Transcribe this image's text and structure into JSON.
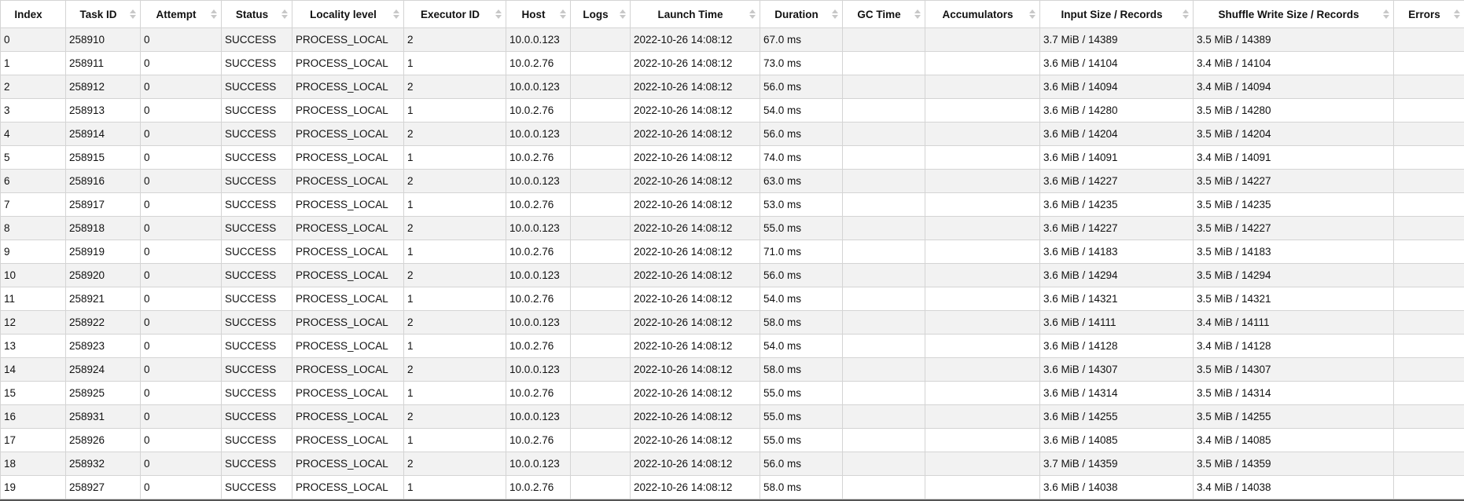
{
  "table": {
    "columns": [
      {
        "key": "index",
        "label": "Index",
        "sortable": false
      },
      {
        "key": "task_id",
        "label": "Task ID",
        "sortable": true
      },
      {
        "key": "attempt",
        "label": "Attempt",
        "sortable": true
      },
      {
        "key": "status",
        "label": "Status",
        "sortable": true
      },
      {
        "key": "locality",
        "label": "Locality level",
        "sortable": true
      },
      {
        "key": "executor_id",
        "label": "Executor ID",
        "sortable": true
      },
      {
        "key": "host",
        "label": "Host",
        "sortable": true
      },
      {
        "key": "logs",
        "label": "Logs",
        "sortable": true
      },
      {
        "key": "launch_time",
        "label": "Launch Time",
        "sortable": true
      },
      {
        "key": "duration",
        "label": "Duration",
        "sortable": true
      },
      {
        "key": "gc_time",
        "label": "GC Time",
        "sortable": true
      },
      {
        "key": "accumulators",
        "label": "Accumulators",
        "sortable": true
      },
      {
        "key": "input_size",
        "label": "Input Size / Records",
        "sortable": true
      },
      {
        "key": "shuffle_write",
        "label": "Shuffle Write Size / Records",
        "sortable": true
      },
      {
        "key": "errors",
        "label": "Errors",
        "sortable": true
      }
    ],
    "rows": [
      [
        "0",
        "258910",
        "0",
        "SUCCESS",
        "PROCESS_LOCAL",
        "2",
        "10.0.0.123",
        "",
        "2022-10-26 14:08:12",
        "67.0 ms",
        "",
        "",
        "3.7 MiB / 14389",
        "3.5 MiB / 14389",
        ""
      ],
      [
        "1",
        "258911",
        "0",
        "SUCCESS",
        "PROCESS_LOCAL",
        "1",
        "10.0.2.76",
        "",
        "2022-10-26 14:08:12",
        "73.0 ms",
        "",
        "",
        "3.6 MiB / 14104",
        "3.4 MiB / 14104",
        ""
      ],
      [
        "2",
        "258912",
        "0",
        "SUCCESS",
        "PROCESS_LOCAL",
        "2",
        "10.0.0.123",
        "",
        "2022-10-26 14:08:12",
        "56.0 ms",
        "",
        "",
        "3.6 MiB / 14094",
        "3.4 MiB / 14094",
        ""
      ],
      [
        "3",
        "258913",
        "0",
        "SUCCESS",
        "PROCESS_LOCAL",
        "1",
        "10.0.2.76",
        "",
        "2022-10-26 14:08:12",
        "54.0 ms",
        "",
        "",
        "3.6 MiB / 14280",
        "3.5 MiB / 14280",
        ""
      ],
      [
        "4",
        "258914",
        "0",
        "SUCCESS",
        "PROCESS_LOCAL",
        "2",
        "10.0.0.123",
        "",
        "2022-10-26 14:08:12",
        "56.0 ms",
        "",
        "",
        "3.6 MiB / 14204",
        "3.5 MiB / 14204",
        ""
      ],
      [
        "5",
        "258915",
        "0",
        "SUCCESS",
        "PROCESS_LOCAL",
        "1",
        "10.0.2.76",
        "",
        "2022-10-26 14:08:12",
        "74.0 ms",
        "",
        "",
        "3.6 MiB / 14091",
        "3.4 MiB / 14091",
        ""
      ],
      [
        "6",
        "258916",
        "0",
        "SUCCESS",
        "PROCESS_LOCAL",
        "2",
        "10.0.0.123",
        "",
        "2022-10-26 14:08:12",
        "63.0 ms",
        "",
        "",
        "3.6 MiB / 14227",
        "3.5 MiB / 14227",
        ""
      ],
      [
        "7",
        "258917",
        "0",
        "SUCCESS",
        "PROCESS_LOCAL",
        "1",
        "10.0.2.76",
        "",
        "2022-10-26 14:08:12",
        "53.0 ms",
        "",
        "",
        "3.6 MiB / 14235",
        "3.5 MiB / 14235",
        ""
      ],
      [
        "8",
        "258918",
        "0",
        "SUCCESS",
        "PROCESS_LOCAL",
        "2",
        "10.0.0.123",
        "",
        "2022-10-26 14:08:12",
        "55.0 ms",
        "",
        "",
        "3.6 MiB / 14227",
        "3.5 MiB / 14227",
        ""
      ],
      [
        "9",
        "258919",
        "0",
        "SUCCESS",
        "PROCESS_LOCAL",
        "1",
        "10.0.2.76",
        "",
        "2022-10-26 14:08:12",
        "71.0 ms",
        "",
        "",
        "3.6 MiB / 14183",
        "3.5 MiB / 14183",
        ""
      ],
      [
        "10",
        "258920",
        "0",
        "SUCCESS",
        "PROCESS_LOCAL",
        "2",
        "10.0.0.123",
        "",
        "2022-10-26 14:08:12",
        "56.0 ms",
        "",
        "",
        "3.6 MiB / 14294",
        "3.5 MiB / 14294",
        ""
      ],
      [
        "11",
        "258921",
        "0",
        "SUCCESS",
        "PROCESS_LOCAL",
        "1",
        "10.0.2.76",
        "",
        "2022-10-26 14:08:12",
        "54.0 ms",
        "",
        "",
        "3.6 MiB / 14321",
        "3.5 MiB / 14321",
        ""
      ],
      [
        "12",
        "258922",
        "0",
        "SUCCESS",
        "PROCESS_LOCAL",
        "2",
        "10.0.0.123",
        "",
        "2022-10-26 14:08:12",
        "58.0 ms",
        "",
        "",
        "3.6 MiB / 14111",
        "3.4 MiB / 14111",
        ""
      ],
      [
        "13",
        "258923",
        "0",
        "SUCCESS",
        "PROCESS_LOCAL",
        "1",
        "10.0.2.76",
        "",
        "2022-10-26 14:08:12",
        "54.0 ms",
        "",
        "",
        "3.6 MiB / 14128",
        "3.4 MiB / 14128",
        ""
      ],
      [
        "14",
        "258924",
        "0",
        "SUCCESS",
        "PROCESS_LOCAL",
        "2",
        "10.0.0.123",
        "",
        "2022-10-26 14:08:12",
        "58.0 ms",
        "",
        "",
        "3.6 MiB / 14307",
        "3.5 MiB / 14307",
        ""
      ],
      [
        "15",
        "258925",
        "0",
        "SUCCESS",
        "PROCESS_LOCAL",
        "1",
        "10.0.2.76",
        "",
        "2022-10-26 14:08:12",
        "55.0 ms",
        "",
        "",
        "3.6 MiB / 14314",
        "3.5 MiB / 14314",
        ""
      ],
      [
        "16",
        "258931",
        "0",
        "SUCCESS",
        "PROCESS_LOCAL",
        "2",
        "10.0.0.123",
        "",
        "2022-10-26 14:08:12",
        "55.0 ms",
        "",
        "",
        "3.6 MiB / 14255",
        "3.5 MiB / 14255",
        ""
      ],
      [
        "17",
        "258926",
        "0",
        "SUCCESS",
        "PROCESS_LOCAL",
        "1",
        "10.0.2.76",
        "",
        "2022-10-26 14:08:12",
        "55.0 ms",
        "",
        "",
        "3.6 MiB / 14085",
        "3.4 MiB / 14085",
        ""
      ],
      [
        "18",
        "258932",
        "0",
        "SUCCESS",
        "PROCESS_LOCAL",
        "2",
        "10.0.0.123",
        "",
        "2022-10-26 14:08:12",
        "56.0 ms",
        "",
        "",
        "3.7 MiB / 14359",
        "3.5 MiB / 14359",
        ""
      ],
      [
        "19",
        "258927",
        "0",
        "SUCCESS",
        "PROCESS_LOCAL",
        "1",
        "10.0.2.76",
        "",
        "2022-10-26 14:08:12",
        "58.0 ms",
        "",
        "",
        "3.6 MiB / 14038",
        "3.4 MiB / 14038",
        ""
      ]
    ]
  }
}
